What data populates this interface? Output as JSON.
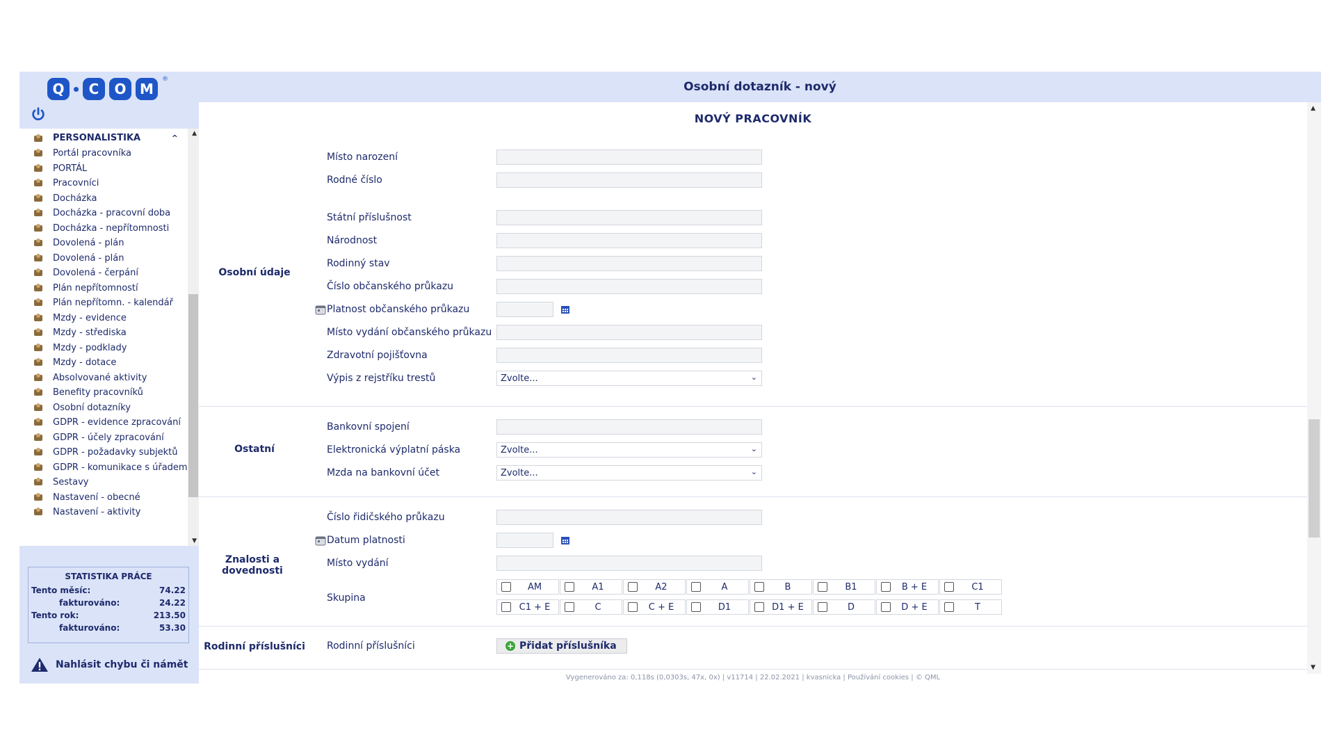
{
  "sidebar": {
    "logo_letters": [
      "Q",
      "C",
      "O",
      "M"
    ],
    "logo_reg": "®",
    "section_title": "PERSONALISTIKA",
    "items": [
      {
        "label": "Portál pracovníka"
      },
      {
        "label": "PORTÁL"
      },
      {
        "label": "Pracovníci"
      },
      {
        "label": "Docházka"
      },
      {
        "label": "Docházka - pracovní doba"
      },
      {
        "label": "Docházka - nepřítomnosti"
      },
      {
        "label": "Dovolená - plán"
      },
      {
        "label": "Dovolená - plán"
      },
      {
        "label": "Dovolená - čerpání"
      },
      {
        "label": "Plán nepřítomností"
      },
      {
        "label": "Plán nepřítomn. - kalendář"
      },
      {
        "label": "Mzdy - evidence"
      },
      {
        "label": "Mzdy - střediska"
      },
      {
        "label": "Mzdy - podklady"
      },
      {
        "label": "Mzdy - dotace"
      },
      {
        "label": "Absolvované aktivity"
      },
      {
        "label": "Benefity pracovníků"
      },
      {
        "label": "Osobní dotazníky"
      },
      {
        "label": "GDPR - evidence zpracování"
      },
      {
        "label": "GDPR - účely zpracování"
      },
      {
        "label": "GDPR - požadavky subjektů"
      },
      {
        "label": "GDPR - komunikace s úřadem"
      },
      {
        "label": "Sestavy"
      },
      {
        "label": "Nastavení - obecné"
      },
      {
        "label": "Nastavení - aktivity"
      }
    ],
    "stats": {
      "title": "STATISTIKA PRÁCE",
      "month_label": "Tento měsíc:",
      "month_value": "74.22",
      "month_billed_label": "fakturováno:",
      "month_billed_value": "24.22",
      "year_label": "Tento rok:",
      "year_value": "213.50",
      "year_billed_label": "fakturováno:",
      "year_billed_value": "53.30"
    },
    "report_label": "Nahlásit chybu či námět"
  },
  "header": {
    "title": "Osobní dotazník - nový"
  },
  "form": {
    "title": "NOVÝ PRACOVNÍK",
    "sections": {
      "personal": {
        "label": "Osobní údaje",
        "fields": {
          "birthplace": "Místo narození",
          "birth_number": "Rodné číslo",
          "citizenship": "Státní příslušnost",
          "nationality": "Národnost",
          "marital_status": "Rodinný stav",
          "id_card_number": "Číslo občanského průkazu",
          "id_card_validity": "Platnost občanského průkazu",
          "id_card_issue_place": "Místo vydání občanského průkazu",
          "health_insurance": "Zdravotní pojišťovna",
          "criminal_record": "Výpis z rejstříku trestů"
        },
        "criminal_record_value": "Zvolte..."
      },
      "other": {
        "label": "Ostatní",
        "fields": {
          "bank": "Bankovní spojení",
          "e_payslip": "Elektronická výplatní páska",
          "salary_to_bank": "Mzda na bankovní účet"
        },
        "e_payslip_value": "Zvolte...",
        "salary_to_bank_value": "Zvolte..."
      },
      "skills": {
        "label": "Znalosti a dovednosti",
        "fields": {
          "license_number": "Číslo řidičského průkazu",
          "license_validity": "Datum platnosti",
          "license_issue_place": "Místo vydání",
          "group": "Skupina"
        },
        "groups_row1": [
          "AM",
          "A1",
          "A2",
          "A",
          "B",
          "B1",
          "B + E",
          "C1"
        ],
        "groups_row2": [
          "C1 + E",
          "C",
          "C + E",
          "D1",
          "D1 + E",
          "D",
          "D + E",
          "T"
        ]
      },
      "family": {
        "label": "Rodinní příslušníci",
        "field": "Rodinní příslušníci",
        "add_button": "Přidat příslušníka"
      }
    }
  },
  "footer": {
    "text": "Vygenerováno za: 0,118s (0,0303s, 47x, 0x) | v11714 | 22.02.2021 | kvasnicka | Používání cookies | © QML"
  },
  "colors": {
    "brand": "#1e56c8",
    "panel": "#dbe3f8",
    "text": "#1d2a6b",
    "add": "#3aa63a"
  }
}
